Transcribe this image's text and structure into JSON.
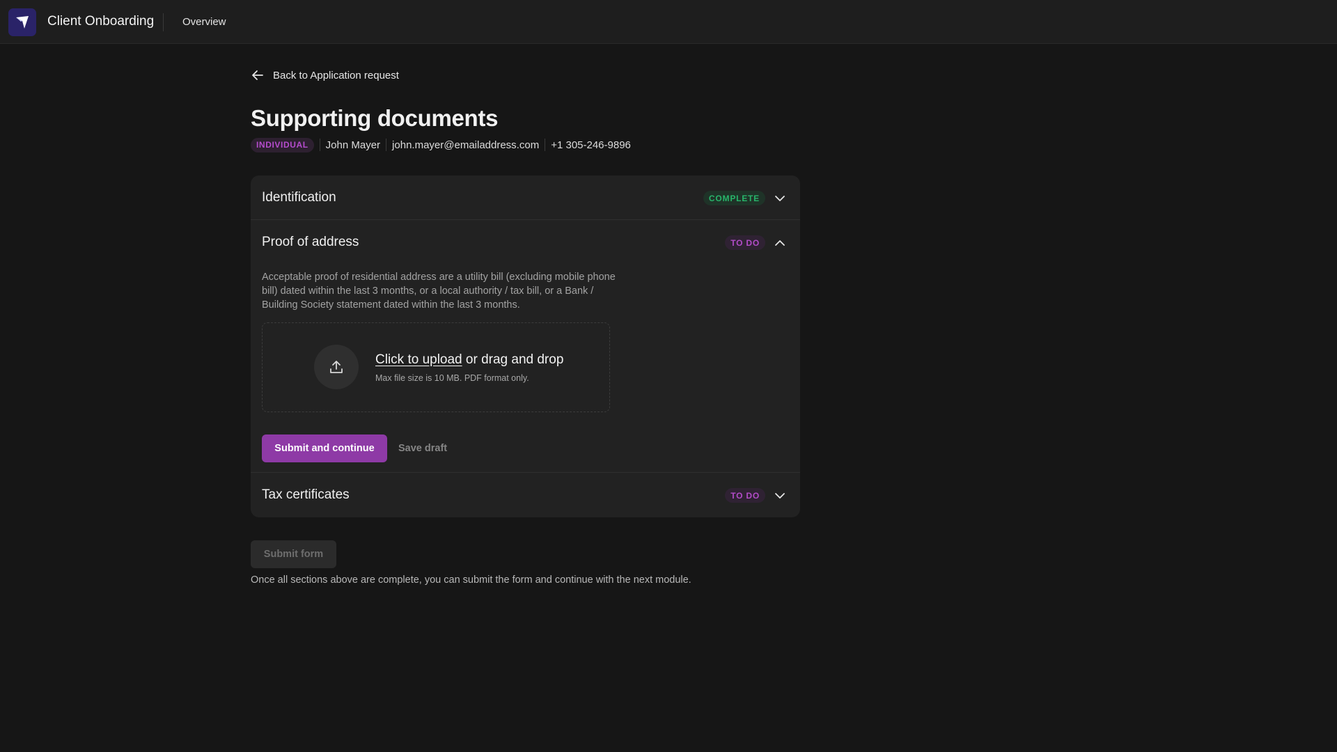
{
  "app": {
    "title": "Client Onboarding",
    "nav_overview": "Overview",
    "logo_icon": "paper-plane-logo-icon",
    "logo_color": "#2a2368"
  },
  "back_link": {
    "label": "Back to Application request",
    "icon": "arrow-left-icon"
  },
  "page": {
    "title": "Supporting documents"
  },
  "applicant": {
    "type_badge": "INDIVIDUAL",
    "name": "John Mayer",
    "email": "john.mayer@emailaddress.com",
    "phone": "+1 305-246-9896"
  },
  "sections": [
    {
      "title": "Identification",
      "status": "COMPLETE",
      "expanded": false,
      "status_color": "#28b46a"
    },
    {
      "title": "Proof of address",
      "status": "TO DO",
      "expanded": true,
      "status_color": "#b24cc8",
      "description": "Acceptable proof of residential address are a utility bill (excluding mobile phone bill) dated within the last 3 months, or a local authority / tax bill, or a Bank / Building Society statement dated within the last 3 months.",
      "upload": {
        "link_text": "Click to upload",
        "rest_text": " or drag and drop",
        "hint": "Max file size is 10 MB. PDF format only.",
        "icon": "upload-icon"
      },
      "primary_button": "Submit and continue",
      "secondary_button": "Save draft"
    },
    {
      "title": "Tax certificates",
      "status": "TO DO",
      "expanded": false,
      "status_color": "#b24cc8"
    }
  ],
  "footer": {
    "submit_button": "Submit form",
    "note": "Once all sections above are complete, you can submit the form and continue with the next module."
  },
  "colors": {
    "accent": "#8e3aa6",
    "background": "#161616",
    "card": "#222222"
  }
}
